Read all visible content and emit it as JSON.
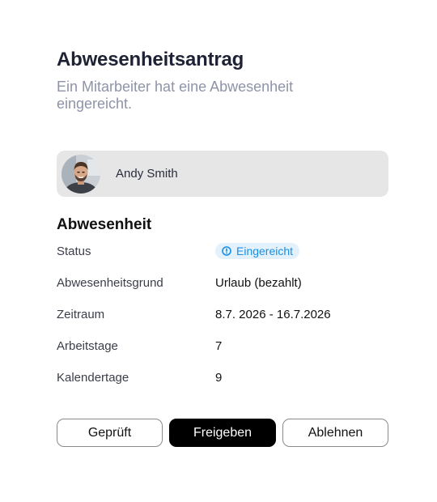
{
  "header": {
    "title": "Abwesenheitsantrag",
    "subtitle": "Ein Mitarbeiter hat eine Abwesenheit eingereicht."
  },
  "employee": {
    "name": "Andy Smith",
    "avatar_icon": "user-photo"
  },
  "absence": {
    "section_title": "Abwesenheit",
    "status_label": "Status",
    "status_value": "Eingereicht",
    "status_color": "#1a8fe3",
    "status_icon": "info-icon",
    "rows": [
      {
        "label": "Abwesenheitsgrund",
        "value": "Urlaub (bezahlt)"
      },
      {
        "label": "Zeitraum",
        "value": "8.7. 2026 - 16.7.2026"
      },
      {
        "label": "Arbeitstage",
        "value": "7"
      },
      {
        "label": "Kalendertage",
        "value": "9"
      }
    ]
  },
  "actions": {
    "checked_label": "Geprüft",
    "approve_label": "Freigeben",
    "reject_label": "Ablehnen"
  }
}
